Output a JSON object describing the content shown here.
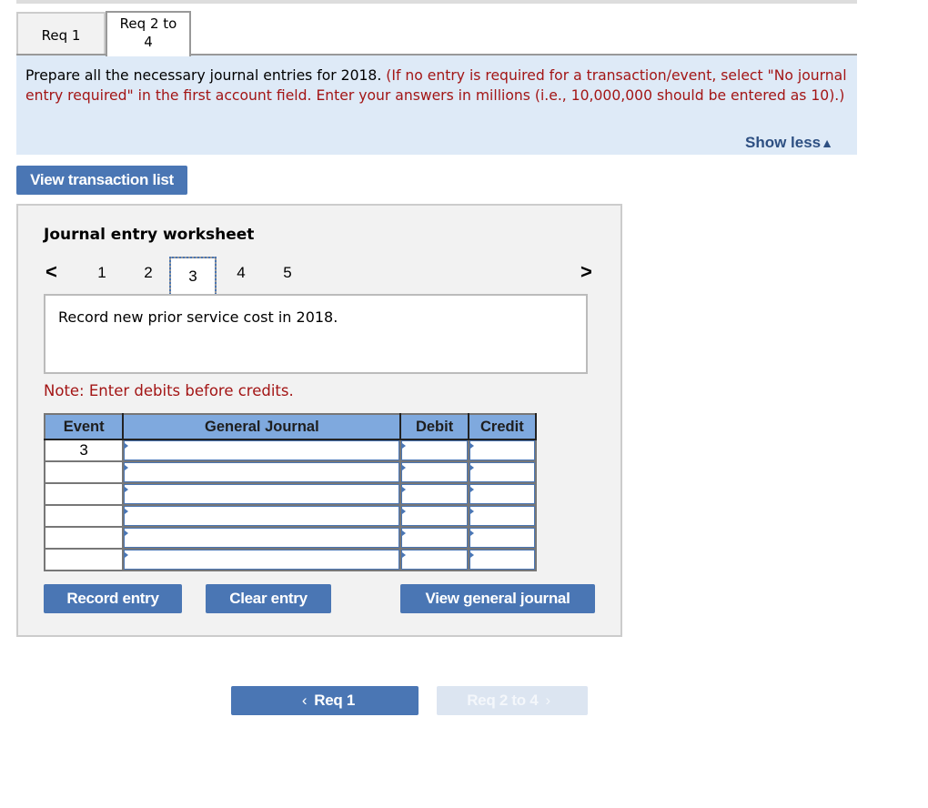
{
  "tabs": [
    {
      "label": "Req 1",
      "active": false
    },
    {
      "label": "Req 2 to 4",
      "label_line1": "Req 2 to",
      "label_line2": "4",
      "active": true
    }
  ],
  "instructions": {
    "main_text": "Prepare all the necessary journal entries for 2018.",
    "note_text": "(If no entry is required for a transaction/event, select \"No journal entry required\" in the first account field. Enter your answers in millions (i.e., 10,000,000 should be entered as 10).)",
    "show_less_label": "Show less",
    "show_less_icon": "triangle-up-icon"
  },
  "view_transaction_list_label": "View transaction list",
  "worksheet": {
    "title": "Journal entry worksheet",
    "pages": [
      "1",
      "2",
      "3",
      "4",
      "5"
    ],
    "current_page": "3",
    "prev_icon": "<",
    "next_icon": ">",
    "description": "Record new prior service cost in 2018.",
    "note": "Note: Enter debits before credits.",
    "table": {
      "headers": [
        "Event",
        "General Journal",
        "Debit",
        "Credit"
      ],
      "rows": [
        {
          "event": "3",
          "account": "",
          "debit": "",
          "credit": ""
        },
        {
          "event": "",
          "account": "",
          "debit": "",
          "credit": ""
        },
        {
          "event": "",
          "account": "",
          "debit": "",
          "credit": ""
        },
        {
          "event": "",
          "account": "",
          "debit": "",
          "credit": ""
        },
        {
          "event": "",
          "account": "",
          "debit": "",
          "credit": ""
        },
        {
          "event": "",
          "account": "",
          "debit": "",
          "credit": ""
        }
      ]
    },
    "buttons": {
      "record": "Record entry",
      "clear": "Clear entry",
      "view_general_journal": "View general journal"
    }
  },
  "bottom_nav": {
    "prev_label": "Req 1",
    "prev_icon": "‹",
    "next_label": "Req 2 to 4",
    "next_icon": "›",
    "next_disabled": true
  },
  "colors": {
    "button_blue": "#4a76b4",
    "instruction_bg": "#deeaf7",
    "note_red": "#a31515",
    "table_header": "#7fa9de",
    "link_blue": "#2d4f82"
  }
}
